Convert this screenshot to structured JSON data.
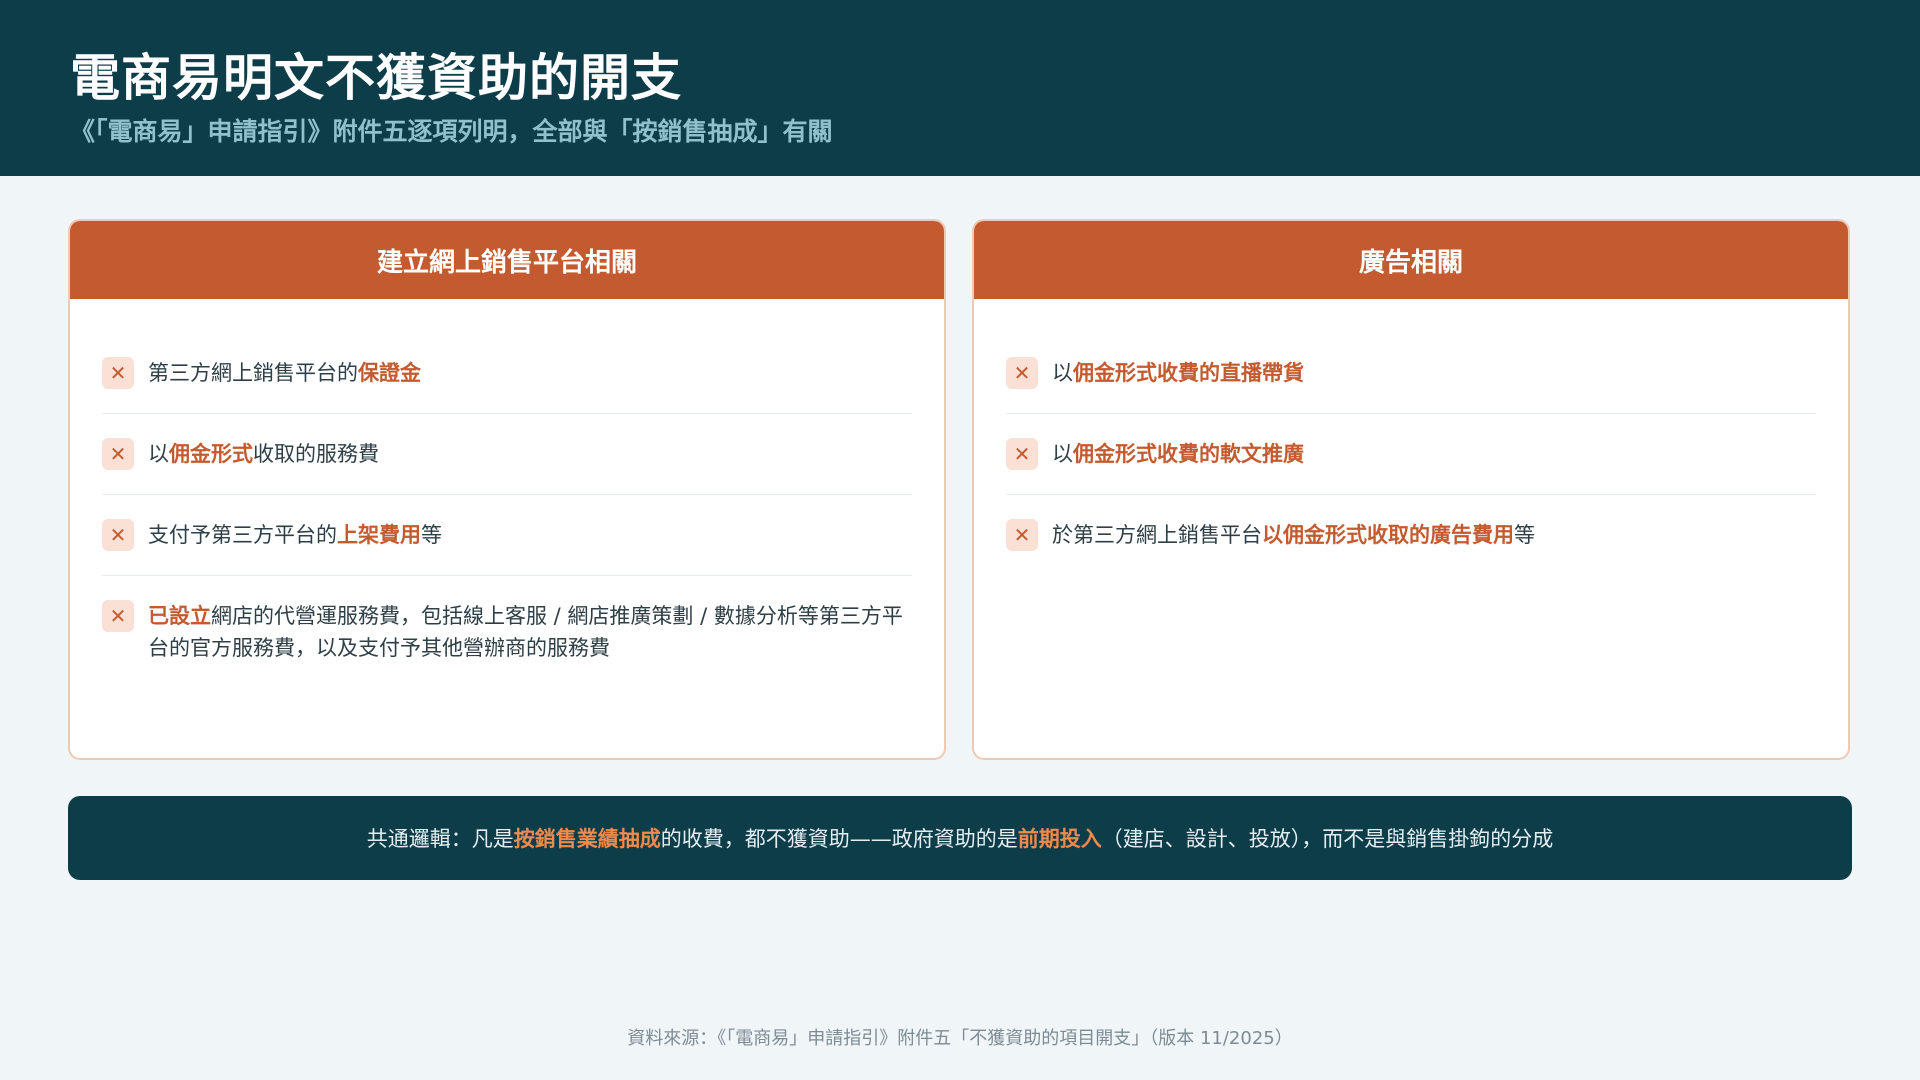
{
  "header": {
    "title": "電商易明文不獲資助的開支",
    "subtitle": "《「電商易」申請指引》附件五逐項列明，全部與「按銷售抽成」有關"
  },
  "left_card": {
    "heading": "建立網上銷售平台相關",
    "items": [
      {
        "pre": "第三方網上銷售平台的",
        "hl": "保證金",
        "post": ""
      },
      {
        "pre": "以",
        "hl": "佣金形式",
        "post": "收取的服務費"
      },
      {
        "pre": "支付予第三方平台的",
        "hl": "上架費用",
        "post": "等"
      },
      {
        "pre": "",
        "hl": "已設立",
        "post": "網店的代營運服務費，包括線上客服 / 網店推廣策劃 / 數據分析等第三方平台的官方服務費，以及支付予其他營辦商的服務費"
      }
    ]
  },
  "right_card": {
    "heading": "廣告相關",
    "items": [
      {
        "pre": "以",
        "hl": "佣金形式收費的直播帶貨",
        "post": ""
      },
      {
        "pre": "以",
        "hl": "佣金形式收費的軟文推廣",
        "post": ""
      },
      {
        "pre": "於第三方網上銷售平台",
        "hl": "以佣金形式收取的廣告費用",
        "post": "等"
      }
    ]
  },
  "banner": {
    "part1": "共通邏輯：凡是",
    "hl1": "按銷售業績抽成",
    "part2": "的收費，都不獲資助——政府資助的是",
    "hl2": "前期投入",
    "part3": "（建店、設計、投放），而不是與銷售掛鉤的分成"
  },
  "footer": {
    "source": "資料來源：《「電商易」申請指引》附件五「不獲資助的項目開支」（版本 11/2025）"
  },
  "icons": {
    "item_marker": "close-x-icon"
  },
  "colors": {
    "header_bg": "#0e3d4a",
    "accent": "#c45b30",
    "banner_highlight": "#f08a4b"
  }
}
